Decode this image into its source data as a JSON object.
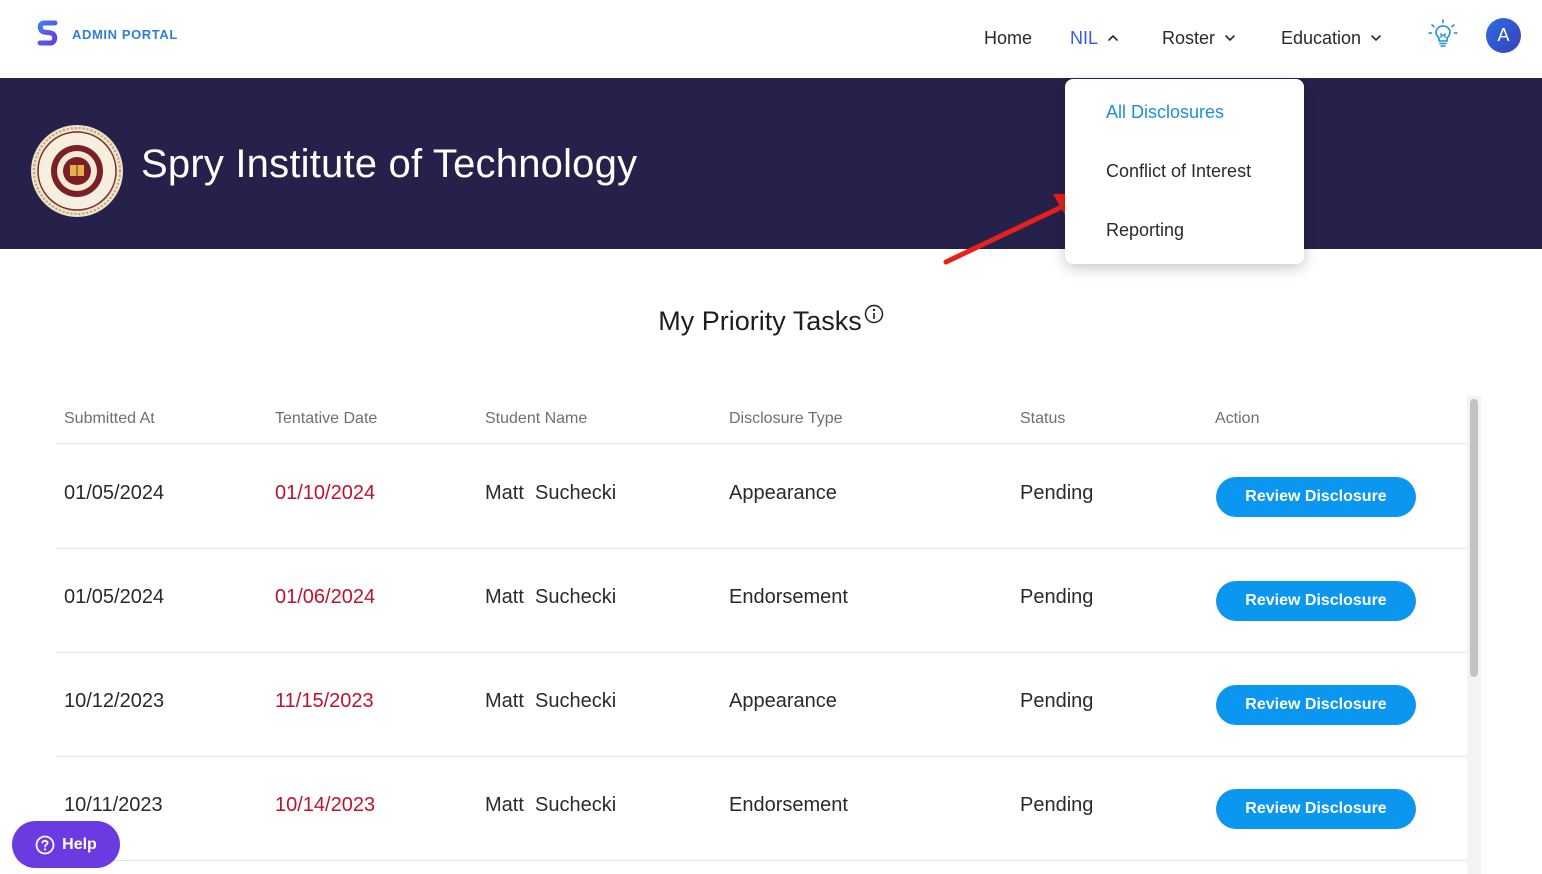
{
  "brand": {
    "name": "ADMIN PORTAL",
    "accent": "#2f7fd6"
  },
  "nav": {
    "home": "Home",
    "nil": "NIL",
    "roster": "Roster",
    "education": "Education",
    "avatar_initial": "A",
    "active_item": "NIL",
    "active_color": "#3b55e6"
  },
  "banner": {
    "institution": "Spry Institute of Technology",
    "background": "#26214a"
  },
  "dropdown": {
    "items": [
      "All Disclosures",
      "Conflict of Interest",
      "Reporting"
    ],
    "selected": "All Disclosures"
  },
  "tasks": {
    "title": "My Priority Tasks",
    "columns": [
      "Submitted At",
      "Tentative Date",
      "Student Name",
      "Disclosure Type",
      "Status",
      "Action"
    ],
    "rows": [
      {
        "submitted": "01/05/2024",
        "tentative": "01/10/2024",
        "student": "Matt  Suchecki",
        "type": "Appearance",
        "status": "Pending",
        "action": "Review Disclosure"
      },
      {
        "submitted": "01/05/2024",
        "tentative": "01/06/2024",
        "student": "Matt  Suchecki",
        "type": "Endorsement",
        "status": "Pending",
        "action": "Review Disclosure"
      },
      {
        "submitted": "10/12/2023",
        "tentative": "11/15/2023",
        "student": "Matt  Suchecki",
        "type": "Appearance",
        "status": "Pending",
        "action": "Review Disclosure"
      },
      {
        "submitted": "10/11/2023",
        "tentative": "10/14/2023",
        "student": "Matt  Suchecki",
        "type": "Endorsement",
        "status": "Pending",
        "action": "Review Disclosure"
      }
    ]
  },
  "help": {
    "label": "Help"
  },
  "colors": {
    "tentative_date": "#c0122e",
    "review_button": "#0b97f0",
    "help_button": "#6a3be0",
    "annotation_arrow": "#e8201c"
  }
}
